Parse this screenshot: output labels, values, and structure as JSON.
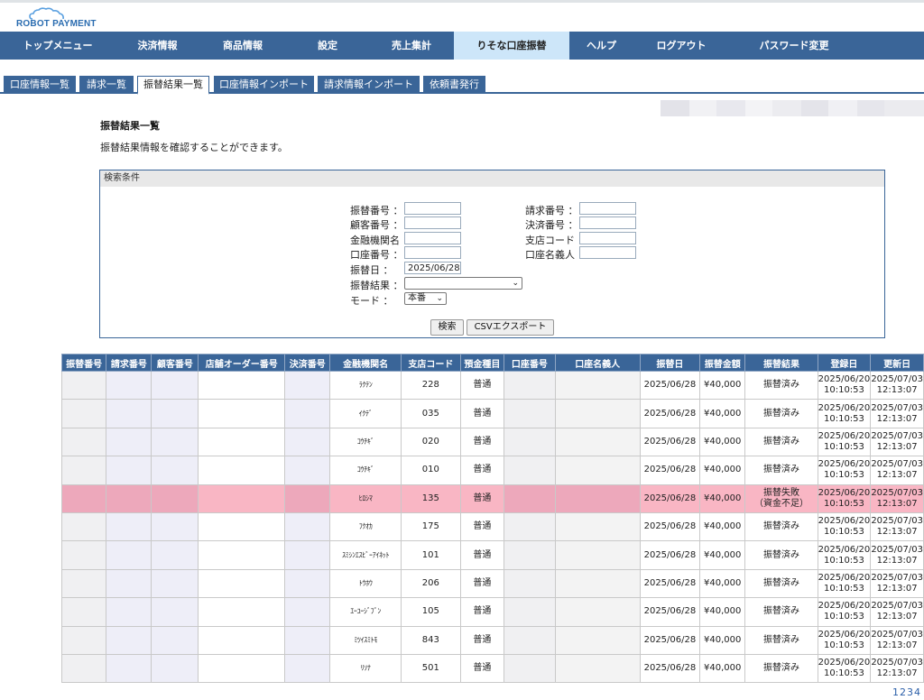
{
  "logo": {
    "text": "ROBOT PAYMENT"
  },
  "mainnav": [
    {
      "label": "トップメニュー",
      "active": false
    },
    {
      "label": "決済情報",
      "active": false
    },
    {
      "label": "商品情報",
      "active": false
    },
    {
      "label": "設定",
      "active": false
    },
    {
      "label": "売上集計",
      "active": false
    },
    {
      "label": "りそな口座振替",
      "active": true
    },
    {
      "label": "ヘルプ",
      "active": false
    },
    {
      "label": "ログアウト",
      "active": false
    },
    {
      "label": "パスワード変更",
      "active": false
    }
  ],
  "subtabs": [
    {
      "label": "口座情報一覧",
      "active": false
    },
    {
      "label": "請求一覧",
      "active": false
    },
    {
      "label": "振替結果一覧",
      "active": true
    },
    {
      "label": "口座情報インポート",
      "active": false
    },
    {
      "label": "請求情報インポート",
      "active": false
    },
    {
      "label": "依頼書発行",
      "active": false
    }
  ],
  "page": {
    "title": "振替結果一覧",
    "description": "振替結果情報を確認することができます。"
  },
  "search": {
    "header": "検索条件",
    "fields": {
      "furikae_no": {
        "label": "振替番号 ：",
        "value": ""
      },
      "seikyu_no": {
        "label": "請求番号 ：",
        "value": ""
      },
      "kokyaku_no": {
        "label": "顧客番号 ：",
        "value": ""
      },
      "kessai_no": {
        "label": "決済番号 ：",
        "value": ""
      },
      "kinyu_name": {
        "label": "金融機関名 ：",
        "value": ""
      },
      "shiten_code": {
        "label": "支店コード ：",
        "value": ""
      },
      "koza_no": {
        "label": "口座番号 ：",
        "value": ""
      },
      "koza_meigi": {
        "label": "口座名義人 ：",
        "value": ""
      },
      "furikae_date": {
        "label": "振替日 ：",
        "value": "2025/06/28"
      },
      "furikae_result": {
        "label": "振替結果 ：",
        "value": ""
      },
      "mode": {
        "label": "モード ：",
        "value": "本番"
      }
    },
    "search_button": "検索",
    "csv_button": "CSVエクスポート"
  },
  "table": {
    "headers": [
      "振替番号",
      "請求番号",
      "顧客番号",
      "店舗オーダー番号",
      "決済番号",
      "金融機関名",
      "支店コード",
      "預金種目",
      "口座番号",
      "口座名義人",
      "振替日",
      "振替金額",
      "振替結果",
      "登録日",
      "更新日"
    ],
    "rows": [
      {
        "bank": "ﾗｸﾃﾝ",
        "branch": "228",
        "type": "普通",
        "date": "2025/06/28",
        "amount": "¥40,000",
        "result": "振替済み",
        "result2": "",
        "reg_date": "2025/06/20",
        "reg_time": "10:10:53",
        "upd_date": "2025/07/03",
        "upd_time": "12:13:07",
        "fail": false
      },
      {
        "bank": "ｲｸﾃﾞ",
        "branch": "035",
        "type": "普通",
        "date": "2025/06/28",
        "amount": "¥40,000",
        "result": "振替済み",
        "result2": "",
        "reg_date": "2025/06/20",
        "reg_time": "10:10:53",
        "upd_date": "2025/07/03",
        "upd_time": "12:13:07",
        "fail": false
      },
      {
        "bank": "ｺｳﾁｷﾞ",
        "branch": "020",
        "type": "普通",
        "date": "2025/06/28",
        "amount": "¥40,000",
        "result": "振替済み",
        "result2": "",
        "reg_date": "2025/06/20",
        "reg_time": "10:10:53",
        "upd_date": "2025/07/03",
        "upd_time": "12:13:07",
        "fail": false
      },
      {
        "bank": "ｺｳﾁｷﾞ",
        "branch": "010",
        "type": "普通",
        "date": "2025/06/28",
        "amount": "¥40,000",
        "result": "振替済み",
        "result2": "",
        "reg_date": "2025/06/20",
        "reg_time": "10:10:53",
        "upd_date": "2025/07/03",
        "upd_time": "12:13:07",
        "fail": false
      },
      {
        "bank": "ﾋﾛｼﾏ",
        "branch": "135",
        "type": "普通",
        "date": "2025/06/28",
        "amount": "¥40,000",
        "result": "振替失敗",
        "result2": "（資金不足）",
        "reg_date": "2025/06/20",
        "reg_time": "10:10:53",
        "upd_date": "2025/07/03",
        "upd_time": "12:13:07",
        "fail": true
      },
      {
        "bank": "ﾌｸｵｶ",
        "branch": "175",
        "type": "普通",
        "date": "2025/06/28",
        "amount": "¥40,000",
        "result": "振替済み",
        "result2": "",
        "reg_date": "2025/06/20",
        "reg_time": "10:10:53",
        "upd_date": "2025/07/03",
        "upd_time": "12:13:07",
        "fail": false
      },
      {
        "bank": "ｽﾐｼﾝｴｽﾋﾞｰｱｲﾈｯﾄ",
        "branch": "101",
        "type": "普通",
        "date": "2025/06/28",
        "amount": "¥40,000",
        "result": "振替済み",
        "result2": "",
        "reg_date": "2025/06/20",
        "reg_time": "10:10:53",
        "upd_date": "2025/07/03",
        "upd_time": "12:13:07",
        "fail": false
      },
      {
        "bank": "ﾄｳﾎｳ",
        "branch": "206",
        "type": "普通",
        "date": "2025/06/28",
        "amount": "¥40,000",
        "result": "振替済み",
        "result2": "",
        "reg_date": "2025/06/20",
        "reg_time": "10:10:53",
        "upd_date": "2025/07/03",
        "upd_time": "12:13:07",
        "fail": false
      },
      {
        "bank": "ｴｰﾕｰｼﾞﾌﾞﾝ",
        "branch": "105",
        "type": "普通",
        "date": "2025/06/28",
        "amount": "¥40,000",
        "result": "振替済み",
        "result2": "",
        "reg_date": "2025/06/20",
        "reg_time": "10:10:53",
        "upd_date": "2025/07/03",
        "upd_time": "12:13:07",
        "fail": false
      },
      {
        "bank": "ﾐﾂｲｽﾐﾄﾓ",
        "branch": "843",
        "type": "普通",
        "date": "2025/06/28",
        "amount": "¥40,000",
        "result": "振替済み",
        "result2": "",
        "reg_date": "2025/06/20",
        "reg_time": "10:10:53",
        "upd_date": "2025/07/03",
        "upd_time": "12:13:07",
        "fail": false
      },
      {
        "bank": "ﾘｿﾅ",
        "branch": "501",
        "type": "普通",
        "date": "2025/06/28",
        "amount": "¥40,000",
        "result": "振替済み",
        "result2": "",
        "reg_date": "2025/06/20",
        "reg_time": "10:10:53",
        "upd_date": "2025/07/03",
        "upd_time": "12:13:07",
        "fail": false
      }
    ]
  },
  "pager": [
    "1",
    "2",
    "3",
    "4"
  ],
  "colors": {
    "nav": "#3a6598",
    "active_nav": "#cde6f9",
    "fail_row": "#f9b6c4",
    "link": "#2a5ea8"
  }
}
